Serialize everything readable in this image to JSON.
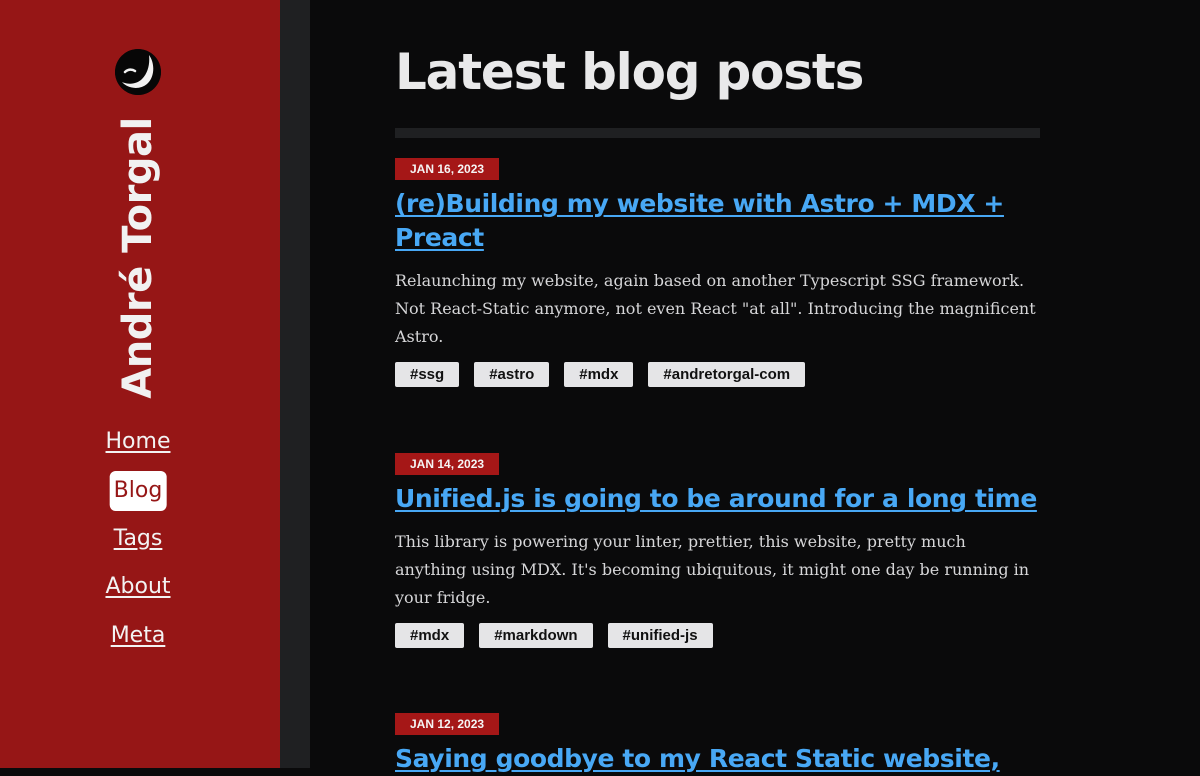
{
  "sidebar": {
    "name": "André Torgal",
    "nav": [
      {
        "label": "Home",
        "active": false
      },
      {
        "label": "Blog",
        "active": true
      },
      {
        "label": "Tags",
        "active": false
      },
      {
        "label": "About",
        "active": false
      },
      {
        "label": "Meta",
        "active": false
      }
    ]
  },
  "main": {
    "title": "Latest blog posts",
    "posts": [
      {
        "date": "JAN 16, 2023",
        "title": "(re)Building my website with Astro + MDX + Preact",
        "excerpt": "Relaunching my website, again based on another Typescript SSG framework. Not React-Static anymore, not even React \"at all\". Introducing the magnificent Astro.",
        "tags": [
          "#ssg",
          "#astro",
          "#mdx",
          "#andretorgal-com"
        ]
      },
      {
        "date": "JAN 14, 2023",
        "title": "Unified.js is going to be around for a long time",
        "excerpt": "This library is powering your linter, prettier, this website, pretty much anything using MDX. It's becoming ubiquitous, it might one day be running in your fridge.",
        "tags": [
          "#mdx",
          "#markdown",
          "#unified-js"
        ]
      },
      {
        "date": "JAN 12, 2023",
        "title": "Saying goodbye to my React Static website,",
        "excerpt": "",
        "tags": []
      }
    ]
  },
  "colors": {
    "sidebar_bg": "#961616",
    "page_bg": "#0a0a0b",
    "link": "#48a8f5",
    "date_badge": "#a51717",
    "tag_bg": "#e5e5e7"
  },
  "icons": {
    "logo": "moon-face-logo-icon"
  }
}
